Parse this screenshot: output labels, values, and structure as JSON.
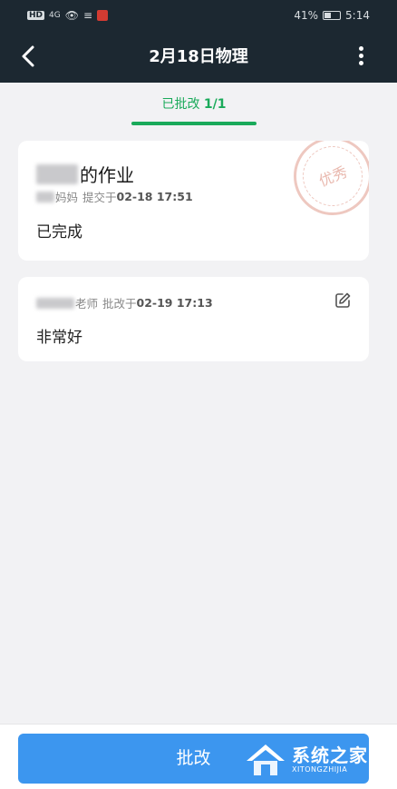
{
  "status_bar": {
    "hd": "HD",
    "signal": "4G",
    "battery_percent": "41%",
    "battery_level": 0.41,
    "time": "5:14"
  },
  "nav": {
    "title": "2月18日物理",
    "back_icon": "chevron-left-icon",
    "more_icon": "more-vertical-icon"
  },
  "tab": {
    "label": "已批改",
    "count": "1/1",
    "color": "#1aaa5a"
  },
  "homework_card": {
    "title_suffix": "的作业",
    "submitter_suffix": "妈妈",
    "submit_label": "提交于",
    "submit_time": "02-18 17:51",
    "content": "已完成",
    "stamp_text": "优秀"
  },
  "review_card": {
    "reviewer_suffix": "老师",
    "review_label": "批改于",
    "review_time": "02-19 17:13",
    "content": "非常好",
    "edit_icon": "edit-icon"
  },
  "bottom": {
    "review_button": "批改",
    "button_color": "#3c96ef"
  },
  "watermark": {
    "name_cn": "系统之家",
    "name_en": "XITONGZHIJIA"
  }
}
